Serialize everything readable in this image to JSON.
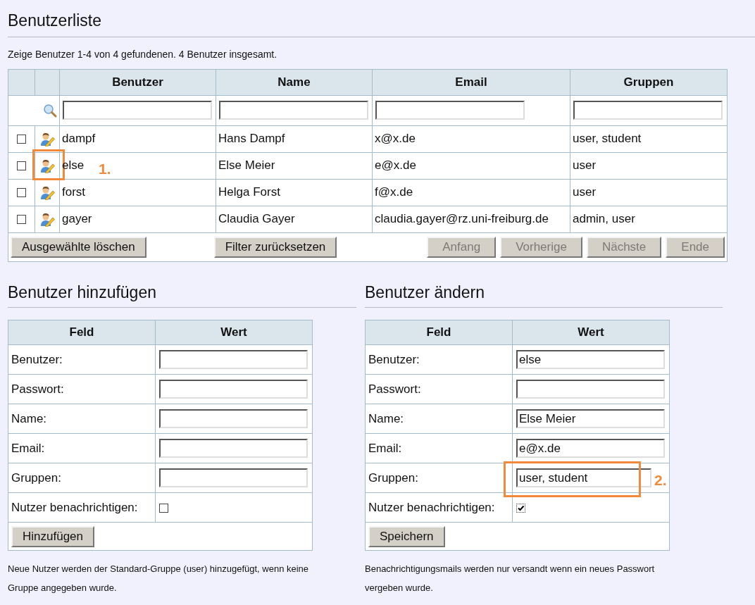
{
  "title": "Benutzerliste",
  "summary": "Zeige Benutzer 1-4 von 4 gefundenen. 4 Benutzer insgesamt.",
  "table": {
    "columns": [
      "Benutzer",
      "Name",
      "Email",
      "Gruppen"
    ],
    "rows": [
      {
        "checked": false,
        "username": "dampf",
        "name": "Hans Dampf",
        "email": "x@x.de",
        "groups": "user, student"
      },
      {
        "checked": false,
        "username": "else",
        "name": "Else Meier",
        "email": "e@x.de",
        "groups": "user",
        "annotation": "1."
      },
      {
        "checked": false,
        "username": "forst",
        "name": "Helga Forst",
        "email": "f@x.de",
        "groups": "user"
      },
      {
        "checked": false,
        "username": "gayer",
        "name": "Claudia Gayer",
        "email": "claudia.gayer@rz.uni-freiburg.de",
        "groups": "admin, user"
      }
    ],
    "delete_button": "Ausgewählte löschen",
    "reset_button": "Filter zurücksetzen",
    "pagination": [
      {
        "label": "Anfang",
        "disabled": true
      },
      {
        "label": "Vorherige",
        "disabled": true
      },
      {
        "label": "Nächste",
        "disabled": true
      },
      {
        "label": "Ende",
        "disabled": true
      }
    ]
  },
  "forms": [
    {
      "title": "Benutzer hinzufügen",
      "columns": [
        "Feld",
        "Wert"
      ],
      "fields": [
        {
          "label": "Benutzer:",
          "kind": "text"
        },
        {
          "label": "Passwort:",
          "kind": "text"
        },
        {
          "label": "Name:",
          "kind": "text"
        },
        {
          "label": "Email:",
          "kind": "text"
        },
        {
          "label": "Gruppen:",
          "kind": "text"
        },
        {
          "label": "Nutzer benachrichtigen:",
          "kind": "checkbox",
          "checked": false
        }
      ],
      "submit": "Hinzufügen",
      "note": "Neue Nutzer werden der Standard-Gruppe (user) hinzugefügt, wenn keine Gruppe angegeben wurde."
    },
    {
      "title": "Benutzer ändern",
      "columns": [
        "Feld",
        "Wert"
      ],
      "fields": [
        {
          "label": "Benutzer:",
          "kind": "text",
          "value": "else"
        },
        {
          "label": "Passwort:",
          "kind": "text"
        },
        {
          "label": "Name:",
          "kind": "text",
          "value": "Else Meier"
        },
        {
          "label": "Email:",
          "kind": "text",
          "value": "e@x.de"
        },
        {
          "label": "Gruppen:",
          "kind": "text",
          "value": "user, student",
          "annotation": "2."
        },
        {
          "label": "Nutzer benachrichtigen:",
          "kind": "checkbox",
          "checked": true
        }
      ],
      "submit": "Speichern",
      "note": "Benachrichtigungsmails werden nur versandt wenn ein neues Passwort vergeben wurde."
    }
  ]
}
